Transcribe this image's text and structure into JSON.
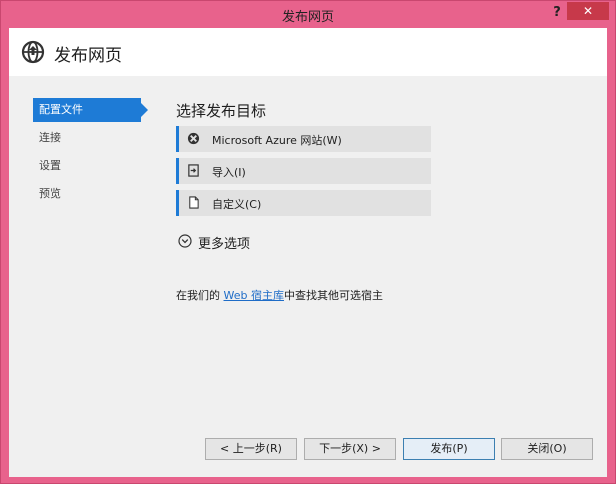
{
  "window": {
    "title": "发布网页",
    "help_label": "?",
    "close_label": "✕"
  },
  "header": {
    "title": "发布网页",
    "icon": "globe-publish-icon"
  },
  "nav": {
    "items": [
      {
        "label": "配置文件",
        "active": true
      },
      {
        "label": "连接",
        "active": false
      },
      {
        "label": "设置",
        "active": false
      },
      {
        "label": "预览",
        "active": false
      }
    ]
  },
  "main": {
    "title": "选择发布目标",
    "targets": [
      {
        "label": "Microsoft Azure 网站(W)",
        "icon": "azure-icon"
      },
      {
        "label": "导入(I)",
        "icon": "import-icon"
      },
      {
        "label": "自定义(C)",
        "icon": "document-icon"
      }
    ],
    "more_options": {
      "label": "更多选项",
      "icon": "chevron-down-circle-icon"
    },
    "host_line": {
      "prefix": "在我们的 ",
      "link": "Web 宿主库",
      "suffix": "中查找其他可选宿主"
    }
  },
  "buttons": {
    "prev": "< 上一步(R)",
    "next": "下一步(X) >",
    "publish": "发布(P)",
    "close": "关闭(O)"
  },
  "colors": {
    "frame": "#e8628c",
    "accent": "#1e7bd6",
    "close_button": "#c7394a",
    "link": "#1e6cc7"
  }
}
